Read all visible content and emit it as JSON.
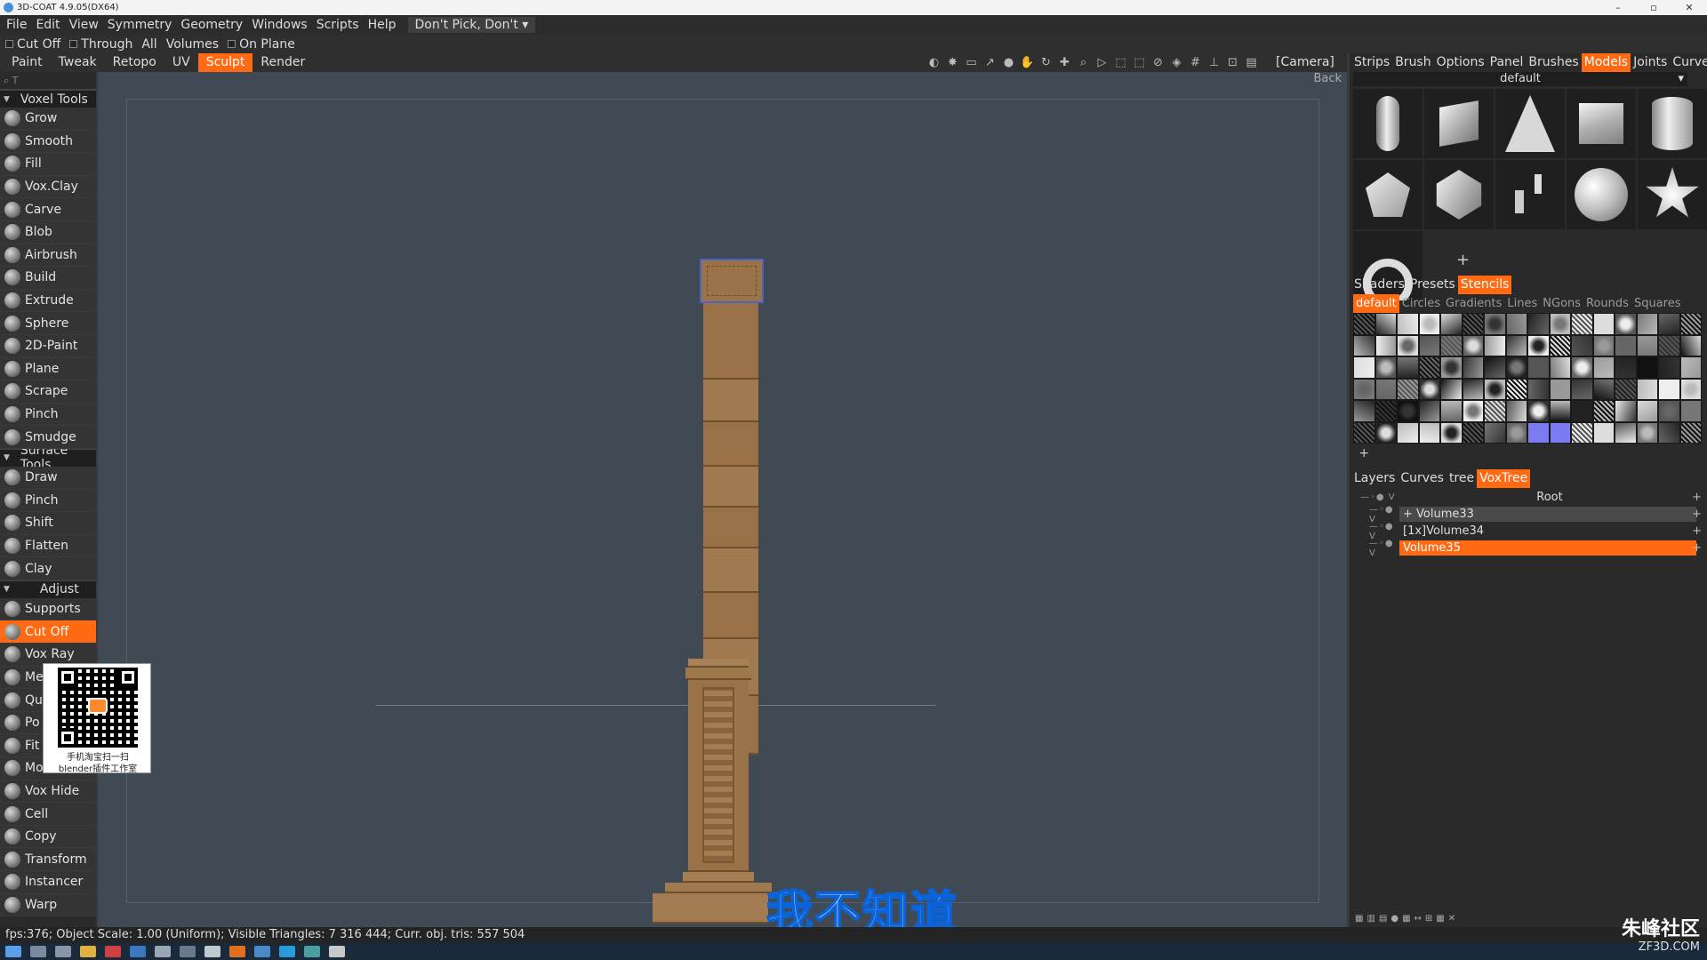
{
  "window": {
    "title": "3D-COAT 4.9.05(DX64)"
  },
  "menubar": {
    "items": [
      "File",
      "Edit",
      "View",
      "Symmetry",
      "Geometry",
      "Windows",
      "Scripts",
      "Help"
    ],
    "pick_mode": "Don't Pick, Don't"
  },
  "options": {
    "cut_off": "Cut  Off",
    "through": "Through",
    "all": "All",
    "volumes": "Volumes",
    "on_plane": "On  Plane"
  },
  "rooms": {
    "items": [
      "Paint",
      "Tweak",
      "Retopo",
      "UV",
      "Sculpt",
      "Render"
    ],
    "active": "Sculpt",
    "camera": "[Camera]"
  },
  "left_toolbar": {
    "voxel_header": "Voxel  Tools",
    "voxel_tools": [
      "Grow",
      "Smooth",
      "Fill",
      "Vox.Clay",
      "Carve",
      "Blob",
      "Airbrush",
      "Build",
      "Extrude",
      "Sphere",
      "2D-Paint",
      "Plane",
      "Scrape",
      "Pinch",
      "Smudge"
    ],
    "surface_header": "Surface  Tools",
    "surface_tools": [
      "Draw",
      "Pinch",
      "Shift",
      "Flatten",
      "Clay"
    ],
    "adjust_header": "Adjust",
    "adjust_tools": [
      "Supports",
      "Cut Off",
      "Vox Ray",
      "Me",
      "Qu",
      "Po",
      "Fit",
      "Mo",
      "Vox Hide",
      "Cell",
      "Copy",
      "Transform",
      "Instancer",
      "Warp"
    ],
    "active_tool": "Cut Off"
  },
  "viewport": {
    "back_label": "Back"
  },
  "subtitle": "我不知道",
  "qr_overlay": {
    "line1": "手机淘宝扫一扫",
    "line2": "blender插件工作室"
  },
  "right_panel": {
    "top_tabs": [
      "Strips",
      "Brush",
      "Options",
      "Panel",
      "Brushes",
      "Models",
      "Joints",
      "Curves"
    ],
    "top_active": "Models",
    "models_dropdown": "default",
    "middle_tabs": [
      "Shaders",
      "Presets",
      "Stencils"
    ],
    "middle_active": "Stencils",
    "stencil_sets": [
      "default",
      "Circles",
      "Gradients",
      "Lines",
      "NGons",
      "Rounds",
      "Squares"
    ],
    "stencil_active": "default",
    "bottom_tabs": [
      "Layers",
      "Curves",
      "tree",
      "VoxTree"
    ],
    "bottom_active": "VoxTree",
    "voxtree": {
      "root": "Root",
      "items": [
        "Volume33",
        "[1x]Volume34",
        "Volume35"
      ],
      "selected": "Volume35"
    }
  },
  "status": "fps:376;   Object Scale: 1.00 (Uniform); Visible Triangles: 7 316 444;  Curr. obj. tris: 557 504",
  "watermark": {
    "brand": "朱峰社区",
    "url": "ZF3D.COM"
  }
}
